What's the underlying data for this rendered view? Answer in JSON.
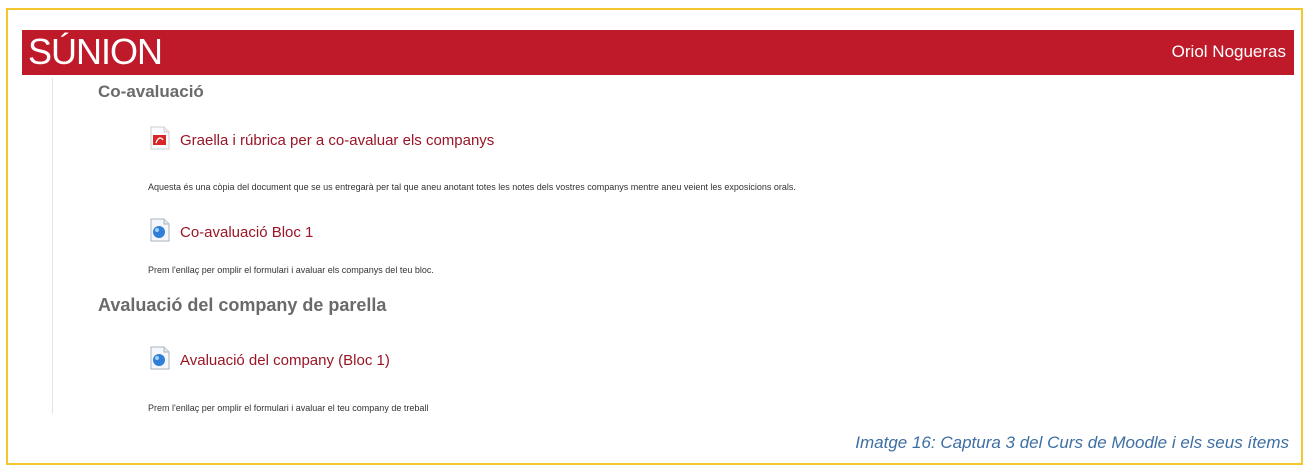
{
  "header": {
    "logo": "SÚNION",
    "user": "Oriol Nogueras"
  },
  "sections": [
    {
      "title": "Co-avaluació",
      "items": [
        {
          "icon": "pdf-icon",
          "label": "Graella i rúbrica per a co-avaluar els companys",
          "description": "Aquesta és una còpia del document que se us entregarà per tal que aneu anotant totes les notes dels vostres companys mentre aneu veient les exposicions orals."
        },
        {
          "icon": "feedback-icon",
          "label": "Co-avaluació Bloc 1",
          "description": "Prem l'enllaç per omplir el formulari i avaluar els companys del teu bloc."
        }
      ]
    },
    {
      "title": "Avaluació del company de parella",
      "items": [
        {
          "icon": "feedback-icon",
          "label": "Avaluació del company (Bloc 1)",
          "description": "Prem l'enllaç per omplir el formulari i avaluar el teu company de treball"
        }
      ]
    }
  ],
  "caption": "Imatge 16: Captura 3 del Curs de Moodle i els seus ítems"
}
